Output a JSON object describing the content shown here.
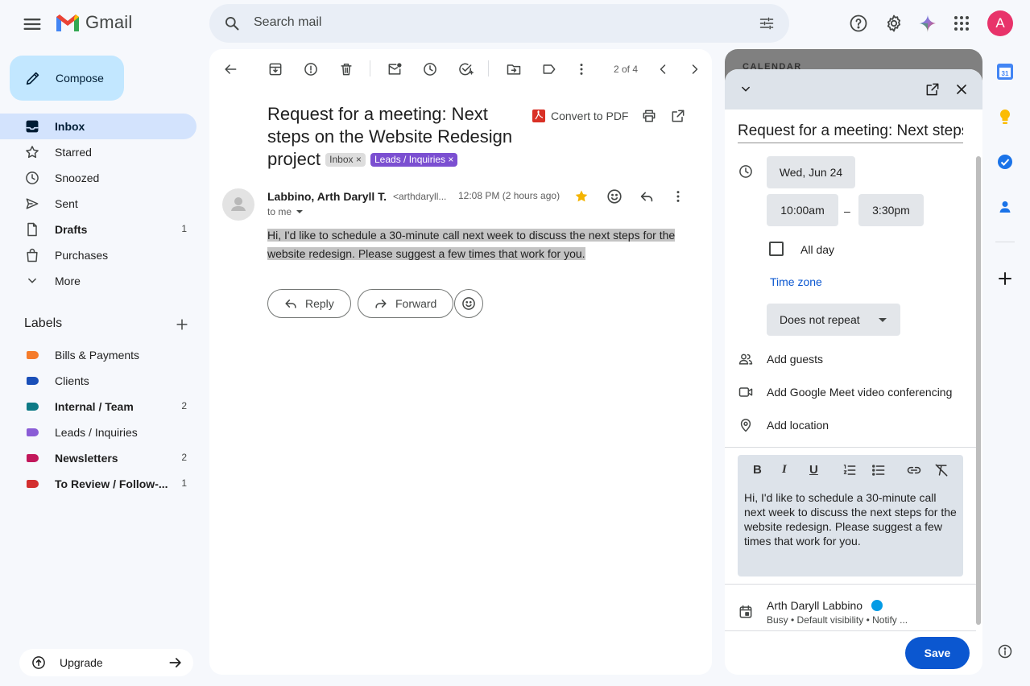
{
  "app": {
    "name": "Gmail"
  },
  "search": {
    "placeholder": "Search mail"
  },
  "user": {
    "avatar_letter": "A"
  },
  "compose": {
    "label": "Compose"
  },
  "nav": [
    {
      "label": "Inbox",
      "count": ""
    },
    {
      "label": "Starred",
      "count": ""
    },
    {
      "label": "Snoozed",
      "count": ""
    },
    {
      "label": "Sent",
      "count": ""
    },
    {
      "label": "Drafts",
      "count": "1"
    },
    {
      "label": "Purchases",
      "count": ""
    },
    {
      "label": "More",
      "count": ""
    }
  ],
  "labels": {
    "heading": "Labels",
    "items": [
      {
        "label": "Bills & Payments",
        "count": "",
        "color": "#f57c2b"
      },
      {
        "label": "Clients",
        "count": "",
        "color": "#1a4fb8"
      },
      {
        "label": "Internal / Team",
        "count": "2",
        "color": "#0e7a86"
      },
      {
        "label": "Leads / Inquiries",
        "count": "",
        "color": "#8a5cd6"
      },
      {
        "label": "Newsletters",
        "count": "2",
        "color": "#c2185b"
      },
      {
        "label": "To Review / Follow-...",
        "count": "1",
        "color": "#d32f2f"
      }
    ]
  },
  "upgrade": {
    "label": "Upgrade"
  },
  "toolbar": {
    "pager": "2 of 4"
  },
  "email": {
    "subject": "Request for a meeting: Next steps on the Website Redesign project",
    "chip_inbox": "Inbox",
    "chip_label": "Leads / Inquiries",
    "convert_pdf": "Convert to PDF",
    "sender_name": "Labbino, Arth Daryll T.",
    "sender_email": "<arthdaryll...",
    "time": "12:08 PM (2 hours ago)",
    "to": "to me",
    "body": "Hi, I'd like to schedule a 30-minute call next week to discuss the next steps for the website redesign. Please suggest a few times that work for you.",
    "reply_label": "Reply",
    "forward_label": "Forward"
  },
  "calendar": {
    "header": "CALENDAR",
    "title": "Request for a meeting: Next steps on the Website Redesign project",
    "date": "Wed, Jun 24",
    "start_time": "10:00am",
    "dash": "–",
    "end_time": "3:30pm",
    "all_day": "All day",
    "time_zone": "Time zone",
    "repeat": "Does not repeat",
    "add_guests": "Add guests",
    "add_meet": "Add Google Meet video conferencing",
    "add_location": "Add location",
    "description": "Hi, I'd like to schedule a 30-minute call next week to discuss the next steps for the website redesign. Please suggest a few times that work for you.",
    "owner_name": "Arth Daryll Labbino",
    "owner_meta": "Busy • Default visibility • Notify ...",
    "save_label": "Save"
  }
}
